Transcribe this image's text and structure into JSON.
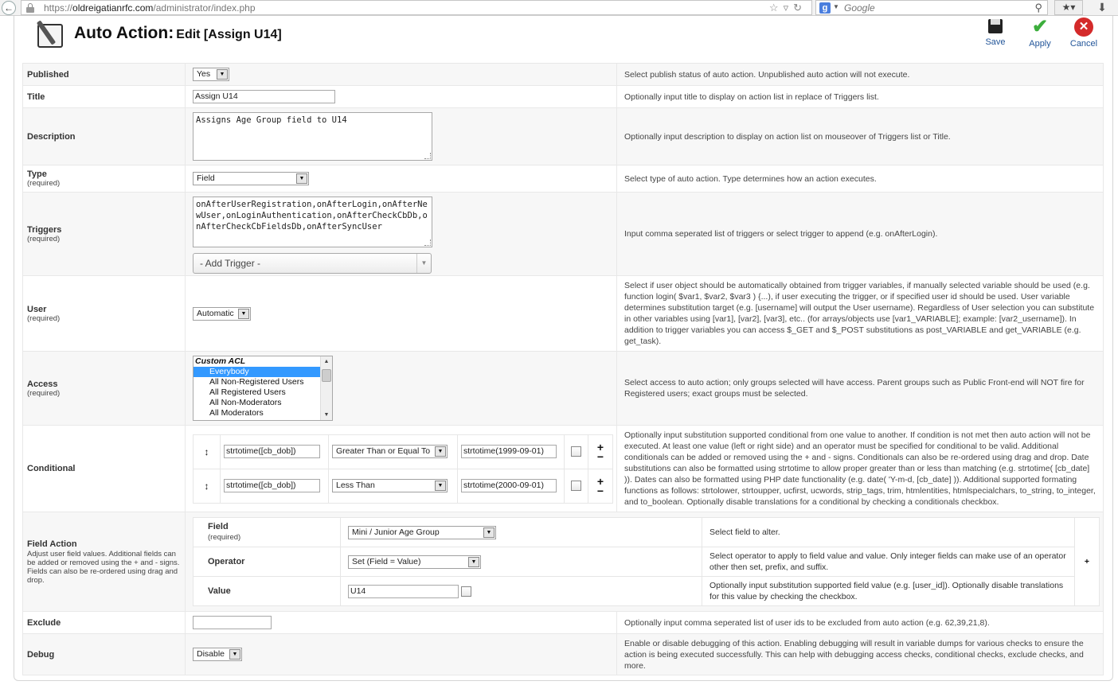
{
  "browser": {
    "url_prefix": "https://",
    "url_host": "oldreigatianrfc.com",
    "url_path": "/administrator/index.php",
    "search_engine_logo": "g",
    "search_placeholder": "Google",
    "icons": {
      "back": "back-arrow-icon",
      "lock": "lock-icon",
      "star": "star-icon",
      "reload": "reload-icon",
      "search": "magnifier-icon",
      "bookmarks": "bookmarks-icon",
      "download": "download-arrow-icon"
    }
  },
  "header": {
    "title_main": "Auto Action:",
    "title_sub": "Edit [Assign U14]"
  },
  "toolbar": {
    "save": "Save",
    "apply": "Apply",
    "cancel": "Cancel"
  },
  "colors": {
    "link_blue": "#225599",
    "apply_green": "#3cae3c",
    "cancel_red": "#d42a2a",
    "selected_option": "#3399ff"
  },
  "form": {
    "published": {
      "label": "Published",
      "value": "Yes",
      "desc": "Select publish status of auto action. Unpublished auto action will not execute."
    },
    "title": {
      "label": "Title",
      "value": "Assign U14",
      "desc": "Optionally input title to display on action list in replace of Triggers list."
    },
    "description": {
      "label": "Description",
      "value": "Assigns Age Group field to U14",
      "desc": "Optionally input description to display on action list on mouseover of Triggers list or Title."
    },
    "type": {
      "label": "Type",
      "required": "(required)",
      "value": "Field",
      "desc": "Select type of auto action. Type determines how an action executes."
    },
    "triggers": {
      "label": "Triggers",
      "required": "(required)",
      "value": "onAfterUserRegistration,onAfterLogin,onAfterNewUser,onLoginAuthentication,onAfterCheckCbDb,onAfterCheckCbFieldsDb,onAfterSyncUser",
      "add_placeholder": "- Add Trigger -",
      "desc": "Input comma seperated list of triggers or select trigger to append (e.g. onAfterLogin)."
    },
    "user": {
      "label": "User",
      "required": "(required)",
      "value": "Automatic",
      "desc": "Select if user object should be automatically obtained from trigger variables, if manually selected variable should be used (e.g. function login( $var1, $var2, $var3 ) {...), if user executing the trigger, or if specified user id should be used. User variable determines substitution target (e.g. [username] will output the User username). Regardless of User selection you can substitute in other variables using [var1], [var2], [var3], etc.. (for arrays/objects use [var1_VARIABLE]; example: [var2_username]). In addition to trigger variables you can access $_GET and $_POST substitutions as post_VARIABLE and get_VARIABLE (e.g. get_task)."
    },
    "access": {
      "label": "Access",
      "required": "(required)",
      "optgroup": "Custom ACL",
      "options": [
        "Everybody",
        "All Non-Registered Users",
        "All Registered Users",
        "All Non-Moderators",
        "All Moderators"
      ],
      "selected": "Everybody",
      "desc": "Select access to auto action; only groups selected will have access. Parent groups such as Public Front-end will NOT fire for Registered users; exact groups must be selected."
    },
    "conditional": {
      "label": "Conditional",
      "rows": [
        {
          "left": "strtotime([cb_dob])",
          "operator": "Greater Than or Equal To",
          "right": "strtotime(1999-09-01)"
        },
        {
          "left": "strtotime([cb_dob])",
          "operator": "Less Than",
          "right": "strtotime(2000-09-01)"
        }
      ],
      "plus": "+",
      "minus": "−",
      "move_glyph": "↕",
      "desc": "Optionally input substitution supported conditional from one value to another. If condition is not met then auto action will not be executed. At least one value (left or right side) and an operator must be specified for conditional to be valid. Additional conditionals can be added or removed using the + and - signs. Conditionals can also be re-ordered using drag and drop. Date substitutions can also be formatted using strtotime to allow proper greater than or less than matching (e.g. strtotime( [cb_date] )). Dates can also be formatted using PHP date functionality (e.g. date( 'Y-m-d, [cb_date] )). Additional supported formating functions as follows: strtolower, strtoupper, ucfirst, ucwords, strip_tags, trim, htmlentities, htmlspecialchars, to_string, to_integer, and to_boolean. Optionally disable translations for a conditional by checking a conditionals checkbox."
    },
    "field_action": {
      "label": "Field Action",
      "note": "Adjust user field values. Additional fields can be added or removed using the + and - signs. Fields can also be re-ordered using drag and drop.",
      "plus": "+",
      "field": {
        "label": "Field",
        "required": "(required)",
        "value": "Mini / Junior Age Group",
        "desc": "Select field to alter."
      },
      "operator": {
        "label": "Operator",
        "value": "Set (Field = Value)",
        "desc": "Select operator to apply to field value and value. Only integer fields can make use of an operator other then set, prefix, and suffix."
      },
      "value": {
        "label": "Value",
        "value": "U14",
        "desc": "Optionally input substitution supported field value (e.g. [user_id]). Optionally disable translations for this value by checking the checkbox."
      }
    },
    "exclude": {
      "label": "Exclude",
      "value": "",
      "desc": "Optionally input comma seperated list of user ids to be excluded from auto action (e.g. 62,39,21,8)."
    },
    "debug": {
      "label": "Debug",
      "value": "Disable",
      "desc": "Enable or disable debugging of this action. Enabling debugging will result in variable dumps for various checks to ensure the action is being executed successfully. This can help with debugging access checks, conditional checks, exclude checks, and more."
    }
  }
}
